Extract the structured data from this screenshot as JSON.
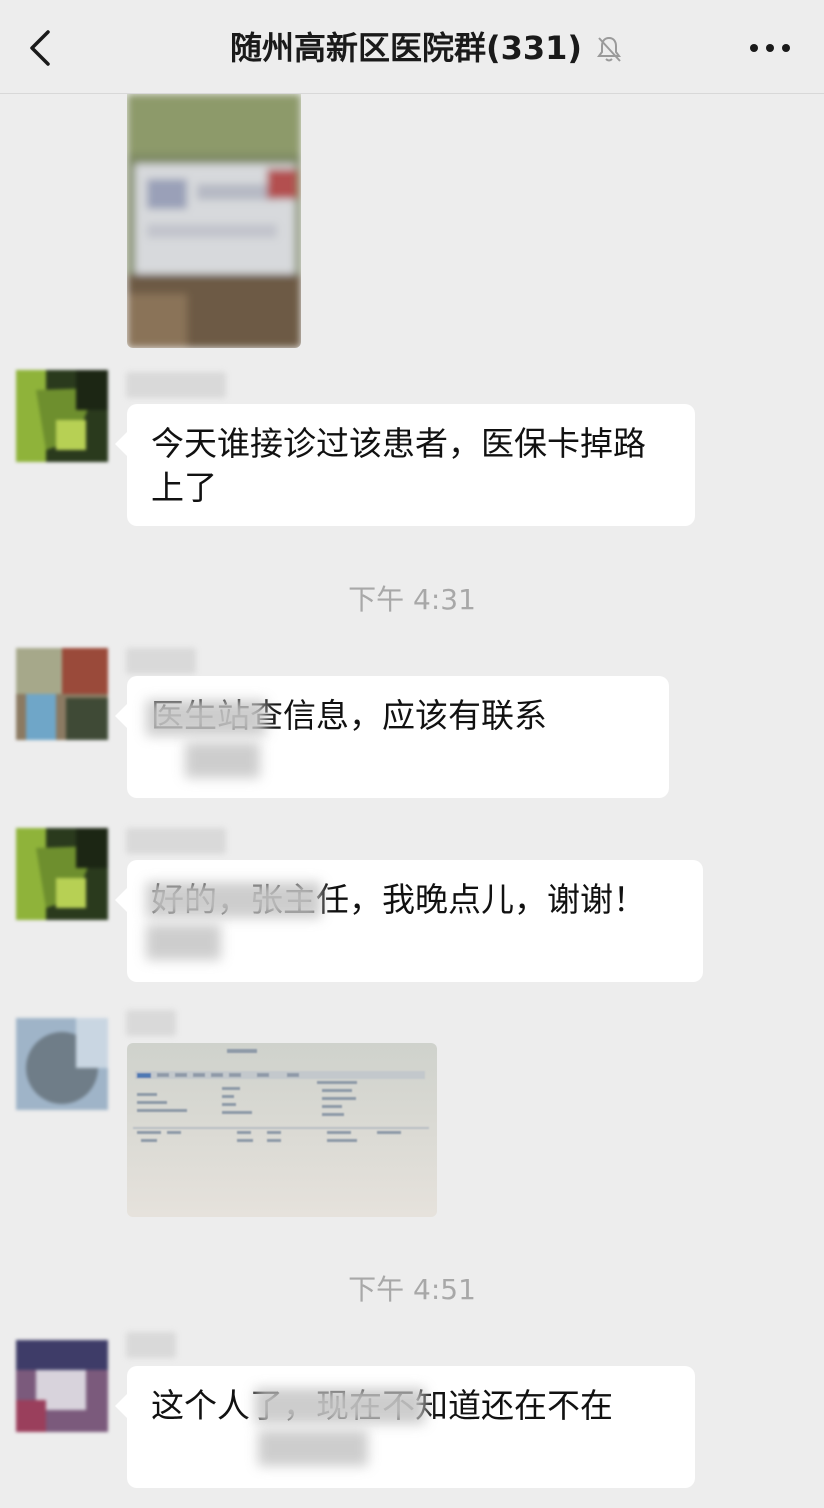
{
  "header": {
    "title": "随州高新区医院群(331)",
    "back_icon": "chevron-left-icon",
    "mute_icon": "bell-muted-icon",
    "more_icon": "more-dots-icon"
  },
  "messages": [
    {
      "type": "image",
      "description_icon": "photo-card"
    },
    {
      "type": "text",
      "text": "今天谁接诊过该患者，医保卡掉路上了"
    },
    {
      "type": "text",
      "text": "医生站查信息，应该有联系"
    },
    {
      "type": "text",
      "text": "好的，张主任，我晚点儿，谢谢！"
    },
    {
      "type": "image",
      "description_icon": "photo-screen"
    },
    {
      "type": "text",
      "text": "这个人了，现在不知道还在不在"
    }
  ],
  "timestamps": [
    "下午 4:31",
    "下午 4:51"
  ],
  "colors": {
    "background": "#ededed",
    "bubble": "#ffffff",
    "timestamp": "#a8a8a8"
  }
}
